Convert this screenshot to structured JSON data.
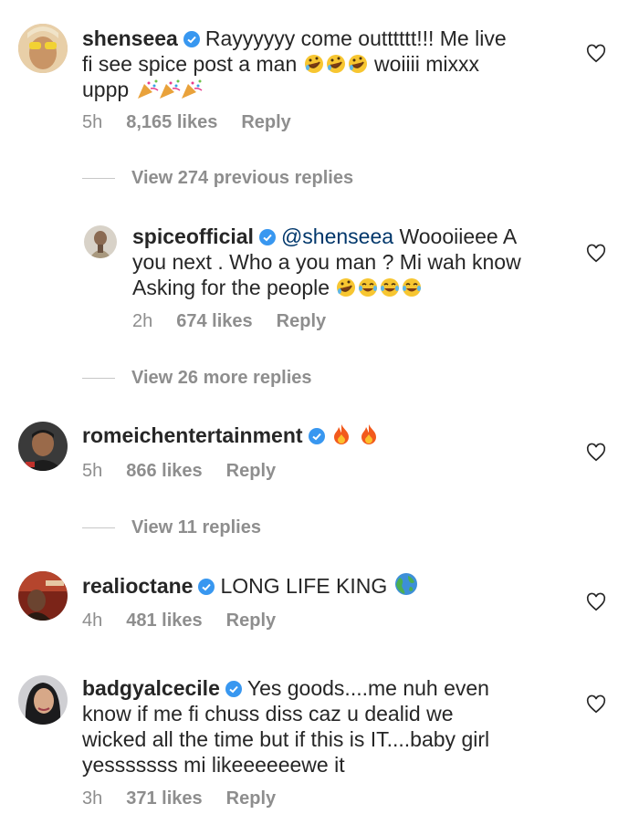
{
  "comments": [
    {
      "username": "shenseea",
      "text_1": "Rayyyyyy come outttttt!!! Me live",
      "text_2": "fi see spice post a man",
      "text_2b": "woiiii mixxx",
      "text_3": "uppp",
      "time": "5h",
      "likes": "8,165 likes",
      "reply": "Reply"
    },
    {
      "username": "spiceofficial",
      "mention": "@shenseea",
      "text_1": "Woooiieee A",
      "text_2": "you next . Who a you man ? Mi wah know",
      "text_3": "Asking for the people",
      "time": "2h",
      "likes": "674 likes",
      "reply": "Reply"
    },
    {
      "username": "romeichentertainment",
      "time": "5h",
      "likes": "866 likes",
      "reply": "Reply"
    },
    {
      "username": "realioctane",
      "text_1": "LONG LIFE KING",
      "time": "4h",
      "likes": "481 likes",
      "reply": "Reply"
    },
    {
      "username": "badgyalcecile",
      "text_1": "Yes goods....me nuh even",
      "text_2": "know if me fi chuss diss caz u dealid we",
      "text_3": "wicked all the time but if this is IT....baby girl",
      "text_4": "yesssssss mi likeeeeeewe it",
      "time": "3h",
      "likes": "371 likes",
      "reply": "Reply"
    }
  ],
  "view_replies": {
    "previous": "View 274 previous replies",
    "more": "View 26 more replies",
    "eleven": "View 11 replies"
  },
  "icons": {
    "heart": "heart-outline-icon",
    "verified": "verified-badge-icon",
    "emojis": [
      "rolling-on-floor-laughing",
      "party-popper",
      "tears-of-joy",
      "fire",
      "globe"
    ]
  },
  "colors": {
    "text": "#262626",
    "meta": "#8e8e8e",
    "verified": "#3897f0",
    "mention": "#00376b"
  }
}
